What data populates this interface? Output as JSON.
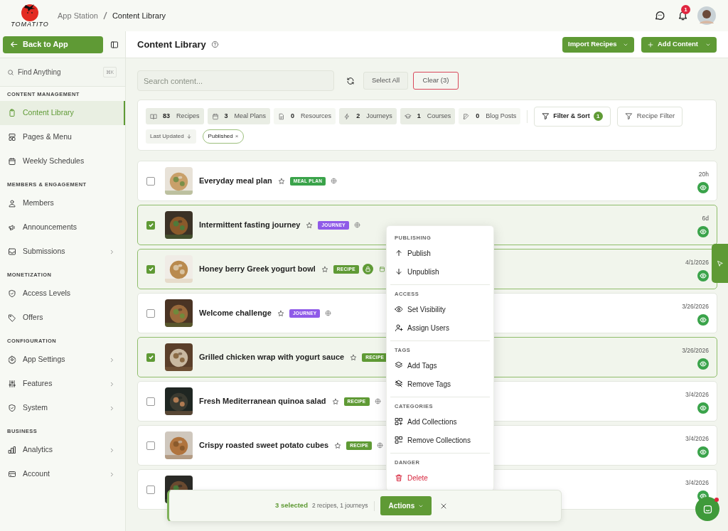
{
  "header": {
    "logo_text": "TOMATITO",
    "breadcrumb": [
      "App Station",
      "Content Library"
    ],
    "notification_count": "1"
  },
  "sidebar": {
    "back_button": "Back to App",
    "search": {
      "placeholder": "Find Anything",
      "shortcut": "⌘K"
    },
    "sections": [
      {
        "title": "CONTENT MANAGEMENT",
        "items": [
          {
            "label": "Content Library",
            "selected": true,
            "has_submenu": false
          },
          {
            "label": "Pages & Menu",
            "selected": false,
            "has_submenu": false
          },
          {
            "label": "Weekly Schedules",
            "selected": false,
            "has_submenu": false
          }
        ]
      },
      {
        "title": "MEMBERS & ENGAGEMENT",
        "items": [
          {
            "label": "Members",
            "selected": false,
            "has_submenu": false
          },
          {
            "label": "Announcements",
            "selected": false,
            "has_submenu": false
          },
          {
            "label": "Submissions",
            "selected": false,
            "has_submenu": true
          }
        ]
      },
      {
        "title": "MONETIZATION",
        "items": [
          {
            "label": "Access Levels",
            "selected": false,
            "has_submenu": false
          },
          {
            "label": "Offers",
            "selected": false,
            "has_submenu": false
          }
        ]
      },
      {
        "title": "CONFIGURATION",
        "items": [
          {
            "label": "App Settings",
            "selected": false,
            "has_submenu": true
          },
          {
            "label": "Features",
            "selected": false,
            "has_submenu": true
          },
          {
            "label": "System",
            "selected": false,
            "has_submenu": true
          }
        ]
      },
      {
        "title": "BUSINESS",
        "items": [
          {
            "label": "Analytics",
            "selected": false,
            "has_submenu": true
          },
          {
            "label": "Account",
            "selected": false,
            "has_submenu": true
          }
        ]
      }
    ]
  },
  "page": {
    "title": "Content Library",
    "buttons": [
      "Import Recipes",
      "Add Content"
    ]
  },
  "toolbar": {
    "search_placeholder": "Search content...",
    "select_all": "Select All",
    "clear": "Clear (3)"
  },
  "stats": [
    {
      "count": "83",
      "label": "Recipes",
      "active": true
    },
    {
      "count": "3",
      "label": "Meal Plans",
      "active": true
    },
    {
      "count": "0",
      "label": "Resources",
      "active": false
    },
    {
      "count": "2",
      "label": "Journeys",
      "active": true
    },
    {
      "count": "1",
      "label": "Courses",
      "active": true
    },
    {
      "count": "0",
      "label": "Blog Posts",
      "active": false
    }
  ],
  "filter_sort": {
    "label": "Filter & Sort",
    "count": "1"
  },
  "recipe_filter": "Recipe Filter",
  "sort_chip": "Last Updated",
  "filter_chips": [
    {
      "label": "Published",
      "remove": "×"
    }
  ],
  "items": [
    {
      "title": "Everyday meal plan",
      "badge": "MEAL PLAN",
      "kind": "meal_plan",
      "checked": false,
      "locked": false,
      "scheduled": false,
      "updated": "20h"
    },
    {
      "title": "Intermittent fasting journey",
      "badge": "JOURNEY",
      "kind": "journey",
      "checked": true,
      "locked": false,
      "scheduled": false,
      "updated": "6d"
    },
    {
      "title": "Honey berry Greek yogurt bowl",
      "badge": "RECIPE",
      "kind": "recipe",
      "checked": true,
      "locked": true,
      "scheduled": true,
      "updated": "4/1/2026"
    },
    {
      "title": "Welcome challenge",
      "badge": "JOURNEY",
      "kind": "journey",
      "checked": false,
      "locked": false,
      "scheduled": false,
      "updated": "3/26/2026"
    },
    {
      "title": "Grilled chicken wrap with yogurt sauce",
      "badge": "RECIPE",
      "kind": "recipe",
      "checked": true,
      "updated": "3/26/2026"
    },
    {
      "title": "Fresh Mediterranean quinoa salad",
      "badge": "RECIPE",
      "kind": "recipe",
      "checked": false,
      "locked": false,
      "scheduled": false,
      "updated": "3/4/2026"
    },
    {
      "title": "Crispy roasted sweet potato cubes",
      "badge": "RECIPE",
      "kind": "recipe",
      "checked": false,
      "locked": false,
      "scheduled": false,
      "updated": "3/4/2026"
    },
    {
      "checked": false,
      "updated": "3/4/2026"
    }
  ],
  "selection_bar": {
    "count": "3 selected",
    "summary": "2 recipes, 1 journeys",
    "actions": "Actions"
  },
  "actions_menu": [
    {
      "title": "PUBLISHING",
      "items": [
        {
          "label": "Publish",
          "danger": false
        },
        {
          "label": "Unpublish",
          "danger": false
        }
      ]
    },
    {
      "title": "ACCESS",
      "items": [
        {
          "label": "Set Visibility",
          "danger": false
        },
        {
          "label": "Assign Users",
          "danger": false
        }
      ]
    },
    {
      "title": "TAGS",
      "items": [
        {
          "label": "Add Tags",
          "danger": false
        },
        {
          "label": "Remove Tags",
          "danger": false
        }
      ]
    },
    {
      "title": "CATEGORIES",
      "items": [
        {
          "label": "Add Collections",
          "danger": false
        },
        {
          "label": "Remove Collections",
          "danger": false
        }
      ]
    },
    {
      "title": "DANGER",
      "items": [
        {
          "label": "Delete",
          "danger": true
        }
      ]
    }
  ]
}
